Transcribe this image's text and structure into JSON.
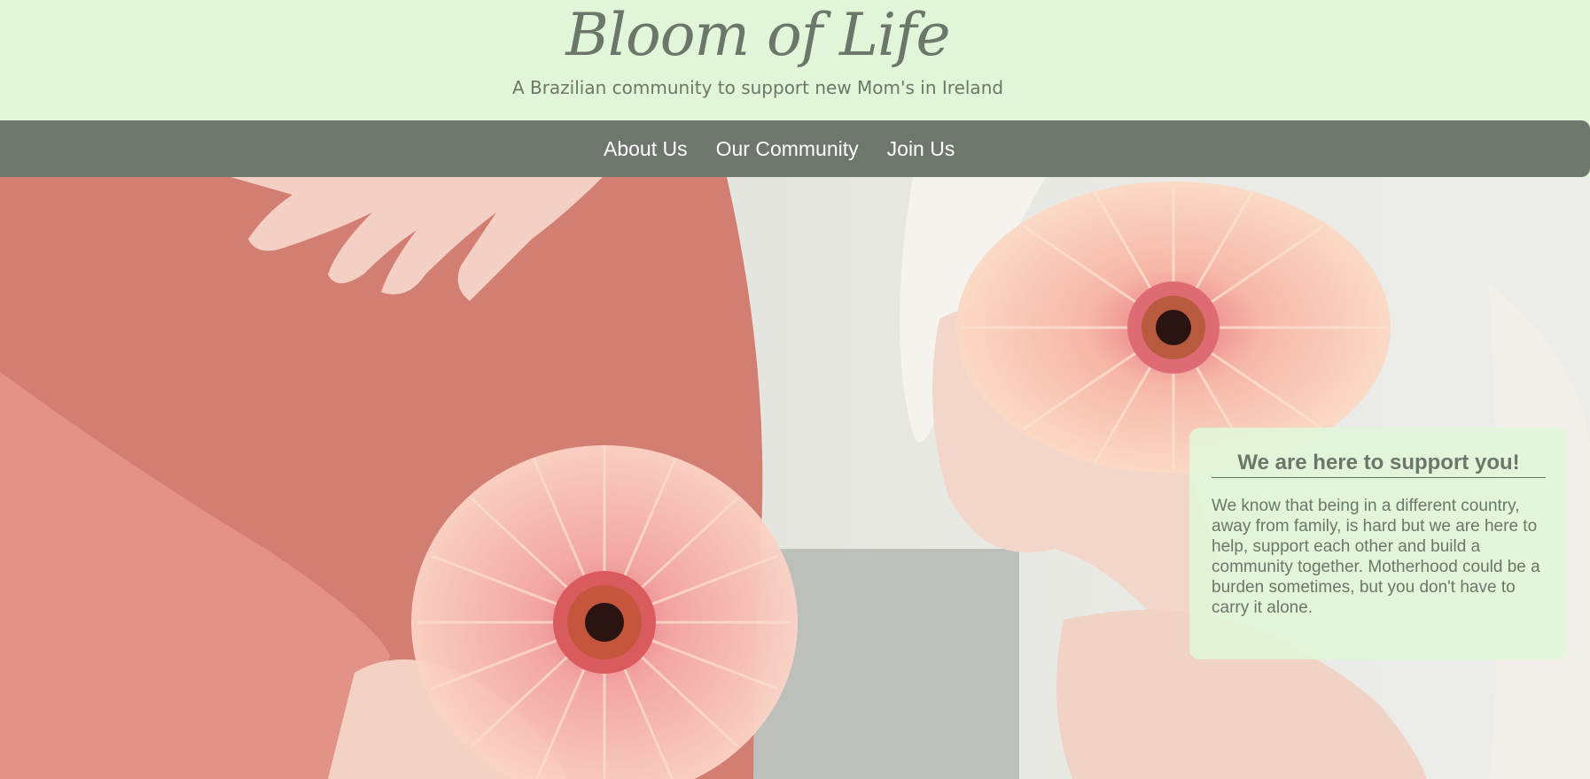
{
  "header": {
    "title": "Bloom of Life",
    "subtitle": "A Brazilian community to support new Mom's in Ireland"
  },
  "nav": {
    "items": [
      {
        "label": "About Us"
      },
      {
        "label": "Our Community"
      },
      {
        "label": "Join Us"
      }
    ]
  },
  "hero": {
    "image": "pregnant-belly-with-pink-gerbera-flowers",
    "colors": {
      "header_bg": "#e1f5d8",
      "nav_bg": "#6e776b",
      "text": "#6b7768",
      "dress": "#d27e73",
      "petal": "#f6b8ac"
    }
  },
  "support_card": {
    "heading": "We are here to support you!",
    "body": "We know that being in a different country, away from family, is hard but we are here to help, support each other and build a community together. Motherhood could be a burden sometimes, but you don't have to carry it alone."
  }
}
